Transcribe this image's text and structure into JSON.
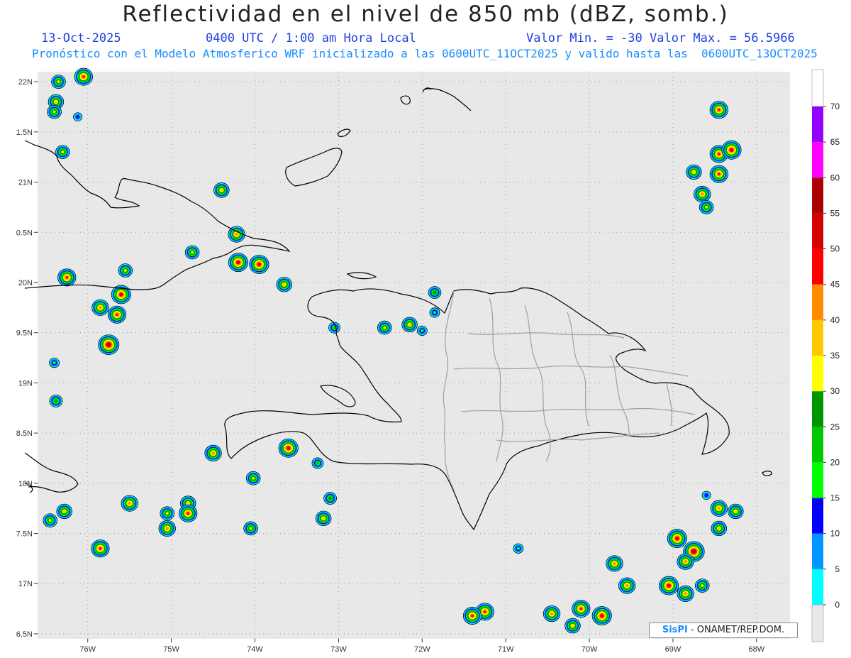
{
  "header": {
    "title": "Reflectividad en el nivel de 850 mb (dBZ, somb.)",
    "date": "13-Oct-2025",
    "time": "0400 UTC / 1:00 am Hora Local",
    "min_label": "Valor Min. = -30",
    "max_label": "Valor Max. = 56.5966",
    "forecast": "Pronóstico con el Modelo Atmosferico WRF inicializado a las 0600UTC_11OCT2025 y valido hasta las  0600UTC_13OCT2025"
  },
  "credit": {
    "logo": "SisPI",
    "text": " - ONAMET/REP.DOM."
  },
  "colors": {
    "map_background": "#e8e8e8",
    "coastline": "#000000",
    "province_border": "#a0a0a0",
    "grid": "#999999"
  },
  "chart_data": {
    "type": "heatmap",
    "title": "Reflectividad en el nivel de 850 mb (dBZ, somb.)",
    "xlim": [
      -76.6,
      -67.6
    ],
    "ylim": [
      16.45,
      22.1
    ],
    "x_ticks": [
      {
        "value": -76,
        "label": "76W"
      },
      {
        "value": -75,
        "label": "75W"
      },
      {
        "value": -74,
        "label": "74W"
      },
      {
        "value": -73,
        "label": "73W"
      },
      {
        "value": -72,
        "label": "72W"
      },
      {
        "value": -71,
        "label": "71W"
      },
      {
        "value": -70,
        "label": "70W"
      },
      {
        "value": -69,
        "label": "69W"
      },
      {
        "value": -68,
        "label": "68W"
      }
    ],
    "y_ticks": [
      {
        "value": 22,
        "label": "22N"
      },
      {
        "value": 21.5,
        "label": "1.5N"
      },
      {
        "value": 21,
        "label": "21N"
      },
      {
        "value": 20.5,
        "label": "0.5N"
      },
      {
        "value": 20,
        "label": "20N"
      },
      {
        "value": 19.5,
        "label": "9.5N"
      },
      {
        "value": 19,
        "label": "19N"
      },
      {
        "value": 18.5,
        "label": "8.5N"
      },
      {
        "value": 18,
        "label": "18N"
      },
      {
        "value": 17.5,
        "label": "7.5N"
      },
      {
        "value": 17,
        "label": "17N"
      },
      {
        "value": 16.5,
        "label": "6.5N"
      }
    ],
    "grid": true,
    "colorbar": {
      "levels": [
        0,
        5,
        10,
        15,
        20,
        25,
        30,
        35,
        40,
        45,
        50,
        55,
        60,
        65,
        70
      ],
      "colors": [
        "#00ffff",
        "#0096ff",
        "#0000ff",
        "#00ff00",
        "#00c800",
        "#009600",
        "#ffff00",
        "#ffc800",
        "#ff8c00",
        "#ff0000",
        "#d40000",
        "#aa0000",
        "#ff00ff",
        "#9600ff"
      ],
      "below_color": "#e8e8e8",
      "above_color": "#ffffff"
    },
    "cells": [
      {
        "lon": -76.35,
        "lat": 22.0,
        "dbz": 30
      },
      {
        "lon": -76.38,
        "lat": 21.8,
        "dbz": 35
      },
      {
        "lon": -76.4,
        "lat": 21.7,
        "dbz": 30
      },
      {
        "lon": -76.12,
        "lat": 21.65,
        "dbz": 10
      },
      {
        "lon": -76.3,
        "lat": 21.3,
        "dbz": 30
      },
      {
        "lon": -76.05,
        "lat": 22.05,
        "dbz": 45
      },
      {
        "lon": -74.4,
        "lat": 20.92,
        "dbz": 35
      },
      {
        "lon": -74.22,
        "lat": 20.48,
        "dbz": 40
      },
      {
        "lon": -73.95,
        "lat": 20.18,
        "dbz": 50
      },
      {
        "lon": -74.2,
        "lat": 20.2,
        "dbz": 50
      },
      {
        "lon": -74.75,
        "lat": 20.3,
        "dbz": 30
      },
      {
        "lon": -75.55,
        "lat": 20.12,
        "dbz": 30
      },
      {
        "lon": -75.6,
        "lat": 19.88,
        "dbz": 50
      },
      {
        "lon": -75.85,
        "lat": 19.75,
        "dbz": 40
      },
      {
        "lon": -75.65,
        "lat": 19.68,
        "dbz": 45
      },
      {
        "lon": -75.75,
        "lat": 19.38,
        "dbz": 55
      },
      {
        "lon": -76.25,
        "lat": 20.05,
        "dbz": 45
      },
      {
        "lon": -76.4,
        "lat": 19.2,
        "dbz": 15
      },
      {
        "lon": -76.38,
        "lat": 18.82,
        "dbz": 25
      },
      {
        "lon": -73.65,
        "lat": 19.98,
        "dbz": 35
      },
      {
        "lon": -72.45,
        "lat": 19.55,
        "dbz": 30
      },
      {
        "lon": -72.15,
        "lat": 19.58,
        "dbz": 35
      },
      {
        "lon": -72.0,
        "lat": 19.52,
        "dbz": 15
      },
      {
        "lon": -71.85,
        "lat": 19.9,
        "dbz": 25
      },
      {
        "lon": -71.85,
        "lat": 19.7,
        "dbz": 15
      },
      {
        "lon": -73.05,
        "lat": 19.55,
        "dbz": 20
      },
      {
        "lon": -73.6,
        "lat": 18.35,
        "dbz": 50
      },
      {
        "lon": -73.25,
        "lat": 18.2,
        "dbz": 20
      },
      {
        "lon": -74.02,
        "lat": 18.05,
        "dbz": 30
      },
      {
        "lon": -74.5,
        "lat": 18.3,
        "dbz": 40
      },
      {
        "lon": -76.28,
        "lat": 17.72,
        "dbz": 35
      },
      {
        "lon": -76.45,
        "lat": 17.63,
        "dbz": 30
      },
      {
        "lon": -75.85,
        "lat": 17.35,
        "dbz": 45
      },
      {
        "lon": -75.5,
        "lat": 17.8,
        "dbz": 40
      },
      {
        "lon": -75.05,
        "lat": 17.7,
        "dbz": 30
      },
      {
        "lon": -75.05,
        "lat": 17.55,
        "dbz": 40
      },
      {
        "lon": -74.8,
        "lat": 17.8,
        "dbz": 35
      },
      {
        "lon": -74.8,
        "lat": 17.7,
        "dbz": 45
      },
      {
        "lon": -73.18,
        "lat": 17.65,
        "dbz": 35
      },
      {
        "lon": -73.1,
        "lat": 17.85,
        "dbz": 25
      },
      {
        "lon": -74.05,
        "lat": 17.55,
        "dbz": 30
      },
      {
        "lon": -70.85,
        "lat": 17.35,
        "dbz": 15
      },
      {
        "lon": -71.25,
        "lat": 16.72,
        "dbz": 45
      },
      {
        "lon": -71.4,
        "lat": 16.68,
        "dbz": 45
      },
      {
        "lon": -70.45,
        "lat": 16.7,
        "dbz": 40
      },
      {
        "lon": -70.1,
        "lat": 16.75,
        "dbz": 45
      },
      {
        "lon": -69.85,
        "lat": 16.68,
        "dbz": 50
      },
      {
        "lon": -70.2,
        "lat": 16.58,
        "dbz": 35
      },
      {
        "lon": -69.7,
        "lat": 17.2,
        "dbz": 40
      },
      {
        "lon": -69.55,
        "lat": 16.98,
        "dbz": 40
      },
      {
        "lon": -69.05,
        "lat": 16.98,
        "dbz": 50
      },
      {
        "lon": -68.75,
        "lat": 17.32,
        "dbz": 56
      },
      {
        "lon": -68.95,
        "lat": 17.45,
        "dbz": 50
      },
      {
        "lon": -68.85,
        "lat": 17.22,
        "dbz": 40
      },
      {
        "lon": -68.85,
        "lat": 16.9,
        "dbz": 40
      },
      {
        "lon": -68.65,
        "lat": 16.98,
        "dbz": 30
      },
      {
        "lon": -68.45,
        "lat": 17.75,
        "dbz": 40
      },
      {
        "lon": -68.25,
        "lat": 17.72,
        "dbz": 35
      },
      {
        "lon": -68.45,
        "lat": 17.55,
        "dbz": 35
      },
      {
        "lon": -68.6,
        "lat": 17.88,
        "dbz": 10
      },
      {
        "lon": -68.45,
        "lat": 21.72,
        "dbz": 45
      },
      {
        "lon": -68.45,
        "lat": 21.28,
        "dbz": 45
      },
      {
        "lon": -68.3,
        "lat": 21.32,
        "dbz": 50
      },
      {
        "lon": -68.45,
        "lat": 21.08,
        "dbz": 45
      },
      {
        "lon": -68.65,
        "lat": 20.88,
        "dbz": 40
      },
      {
        "lon": -68.6,
        "lat": 20.75,
        "dbz": 30
      },
      {
        "lon": -68.75,
        "lat": 21.1,
        "dbz": 35
      }
    ]
  }
}
